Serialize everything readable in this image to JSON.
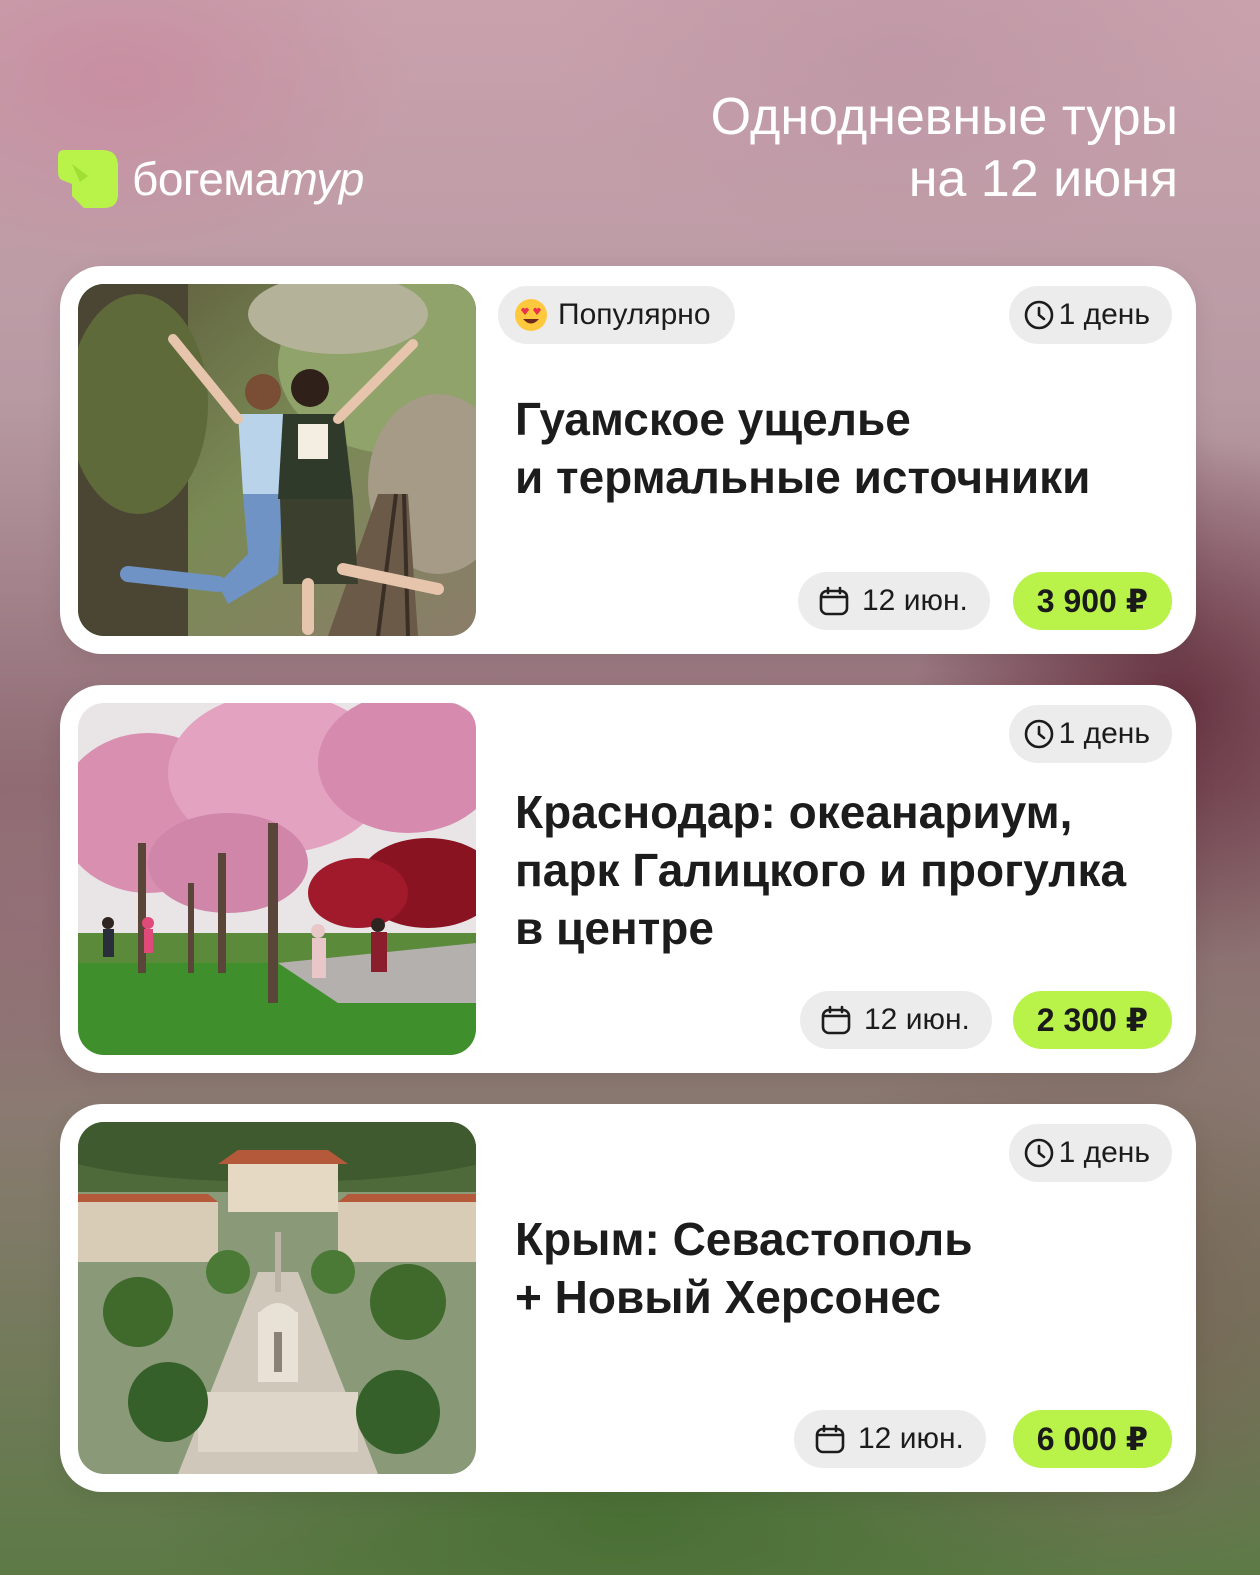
{
  "brand": {
    "name_plain": "богема",
    "name_italic": "тур",
    "accent_color": "#b9f248"
  },
  "headline": {
    "line1": "Однодневные туры",
    "line2": "на 12 июня"
  },
  "tours": [
    {
      "badge": "Популярно",
      "badge_icon": "heart-eyes-emoji",
      "duration": "1 день",
      "title_lines": [
        "Гуамское ущелье",
        "и термальные источники"
      ],
      "date": "12 июн.",
      "price": "3 900 ₽",
      "image": "two women posing on railway in gorge"
    },
    {
      "duration": "1 день",
      "title_lines": [
        "Краснодар: океанариум,",
        "парк Галицкого и прогулка",
        "в центре"
      ],
      "date": "12 июн.",
      "price": "2 300 ₽",
      "image": "park with blooming sakura trees and people"
    },
    {
      "duration": "1 день",
      "title_lines": [
        "Крым: Севастополь",
        "+ Новый Херсонес"
      ],
      "date": "12 июн.",
      "price": "6 000 ₽",
      "image": "aerial view of Chersonesus architecture complex"
    }
  ]
}
